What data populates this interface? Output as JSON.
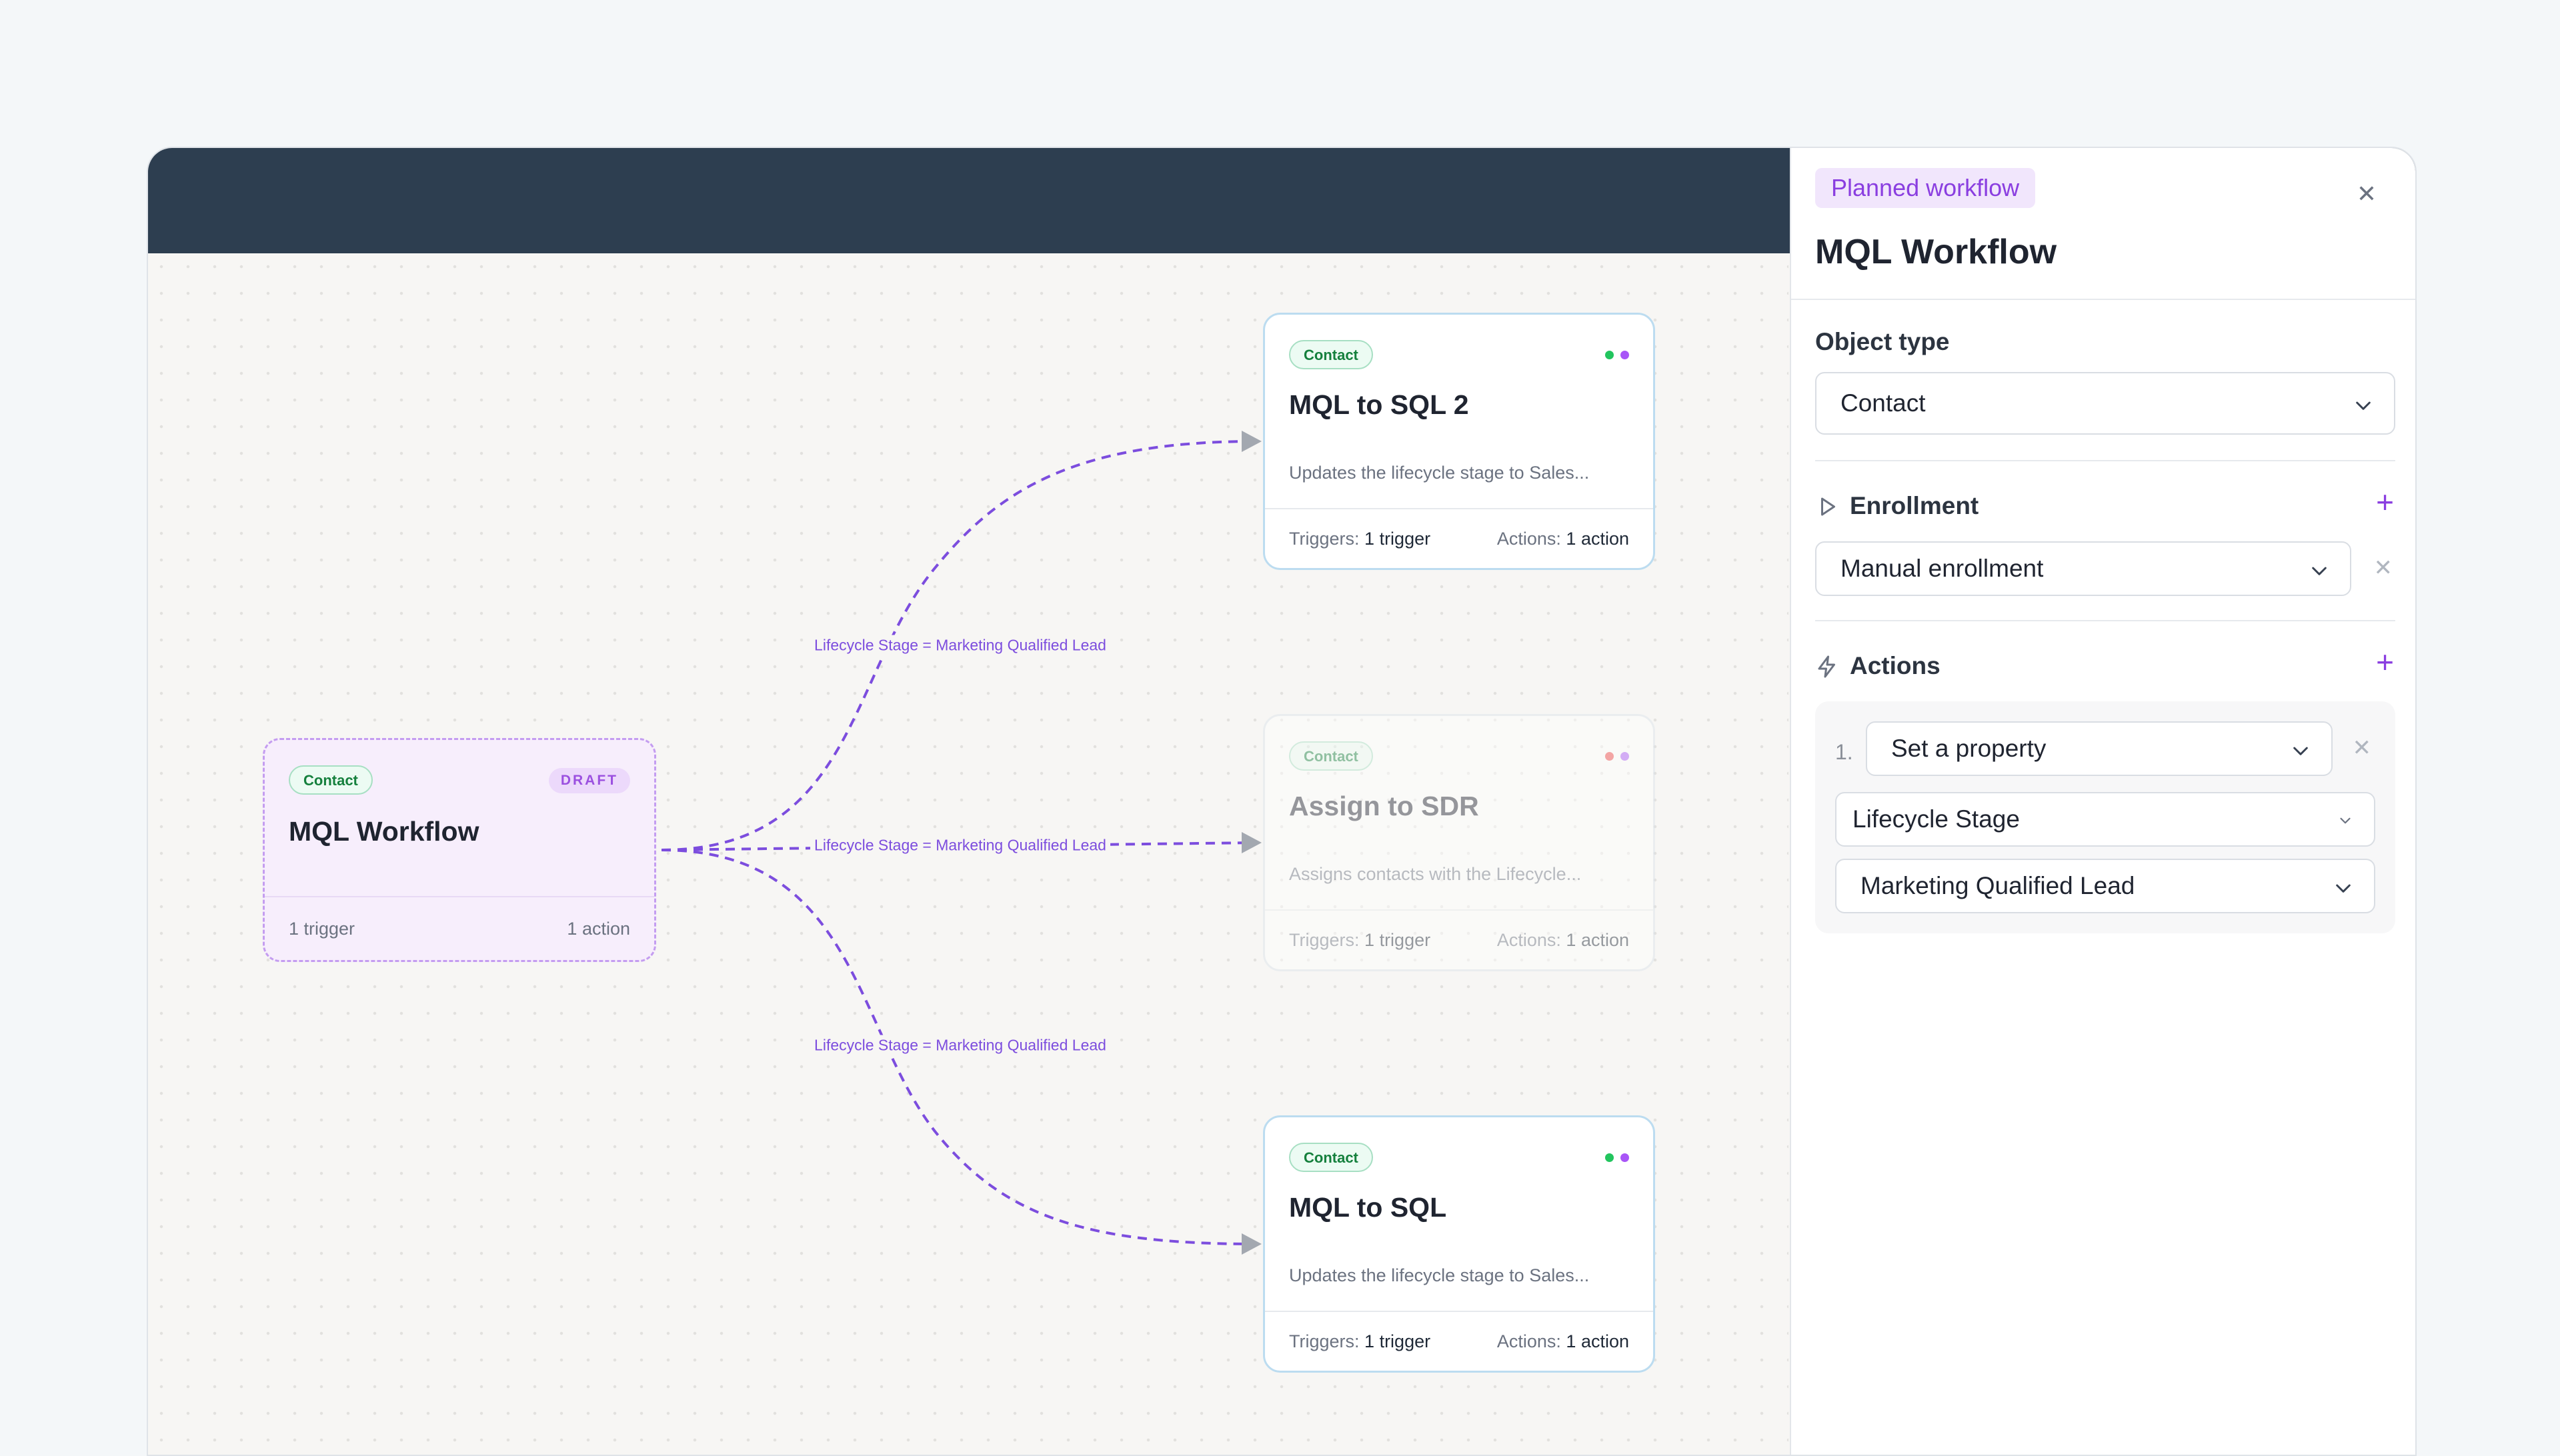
{
  "canvas": {
    "edges": [
      {
        "label": "Lifecycle Stage = Marketing Qualified Lead"
      },
      {
        "label": "Lifecycle Stage = Marketing Qualified Lead"
      },
      {
        "label": "Lifecycle Stage = Marketing Qualified Lead"
      }
    ],
    "source_node": {
      "tag": "Contact",
      "badge": "DRAFT",
      "title": "MQL Workflow",
      "triggers": "1 trigger",
      "actions": "1 action"
    },
    "nodes": [
      {
        "tag": "Contact",
        "title": "MQL to SQL 2",
        "description": "Updates the lifecycle stage to Sales...",
        "triggers_label": "Triggers:",
        "triggers": "1 trigger",
        "actions_label": "Actions:",
        "actions": "1 action",
        "dot_colors": [
          "#22c55e",
          "#a855f7"
        ]
      },
      {
        "tag": "Contact",
        "title": "Assign to SDR",
        "description": "Assigns contacts with the Lifecycle...",
        "triggers_label": "Triggers:",
        "triggers": "1 trigger",
        "actions_label": "Actions:",
        "actions": "1 action",
        "dot_colors": [
          "#ef4444",
          "#a855f7"
        ]
      },
      {
        "tag": "Contact",
        "title": "MQL to SQL",
        "description": "Updates the lifecycle stage to Sales...",
        "triggers_label": "Triggers:",
        "triggers": "1 trigger",
        "actions_label": "Actions:",
        "actions": "1 action",
        "dot_colors": [
          "#22c55e",
          "#a855f7"
        ]
      }
    ]
  },
  "panel": {
    "badge": "Planned workflow",
    "close_icon": "close-icon",
    "title": "MQL Workflow",
    "object_type": {
      "label": "Object type",
      "value": "Contact"
    },
    "enrollment": {
      "label": "Enrollment",
      "icon": "play-outline-icon",
      "value": "Manual enrollment"
    },
    "actions": {
      "label": "Actions",
      "icon": "lightning-icon",
      "steps": [
        {
          "number": "1.",
          "type": "Set a property",
          "property": "Lifecycle Stage",
          "value": "Marketing Qualified Lead"
        }
      ]
    }
  },
  "colors": {
    "accent_purple": "#8a3ee0",
    "topbar": "#2d3e50",
    "contact_green": "#15803d",
    "edge": "#7c4dde"
  }
}
